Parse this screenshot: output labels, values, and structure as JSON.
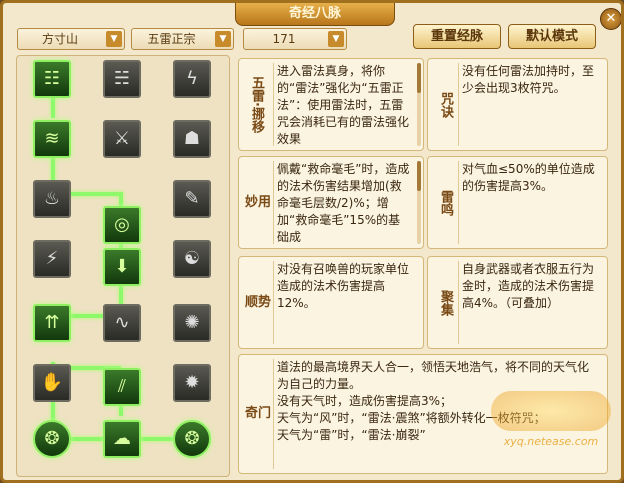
{
  "window": {
    "title": "奇经八脉",
    "close_glyph": "✕"
  },
  "selectors": [
    {
      "value": "方寸山",
      "arrow": "▼"
    },
    {
      "value": "五雷正宗",
      "arrow": "▼"
    },
    {
      "value": "171",
      "arrow": "▼"
    }
  ],
  "buttons": {
    "reset": "重置经脉",
    "default_mode": "默认模式"
  },
  "skills_left": [
    {
      "label": "五雷·挪移",
      "text": "进入雷法真身，将你的“雷法”强化为“五雷正法”：使用雷法时，五雷咒会消耗已有的雷法强化效果"
    },
    {
      "label": "妙用",
      "text": "佩戴“救命毫毛”时，造成的法术伤害结果增加(救命毫毛层数/2)%；增加“救命毫毛”15%的基础成"
    },
    {
      "label": "顺势",
      "text": "对没有召唤兽的玩家单位造成的法术伤害提高12%。"
    },
    {
      "label": "奇门",
      "text": "道法的最高境界天人合一，领悟天地浩气，将不同的天气化为自己的力量。\n没有天气时，造成伤害提高3%；\n天气为“风”时，“雷法·震煞”将额外转化一枚符咒；\n天气为“雷”时，“雷法·崩裂”"
    }
  ],
  "skills_right": [
    {
      "label": "咒诀",
      "text": "没有任何雷法加持时，至少会出现3枚符咒。"
    },
    {
      "label": "雷鸣",
      "text": "对气血≤50%的单位造成的伤害提高3%。"
    },
    {
      "label": "聚集",
      "text": "自身武器或者衣服五行为金时，造成的法术伤害提高4%。（可叠加）"
    }
  ],
  "watermark": {
    "url": "xyq.netease.com"
  }
}
